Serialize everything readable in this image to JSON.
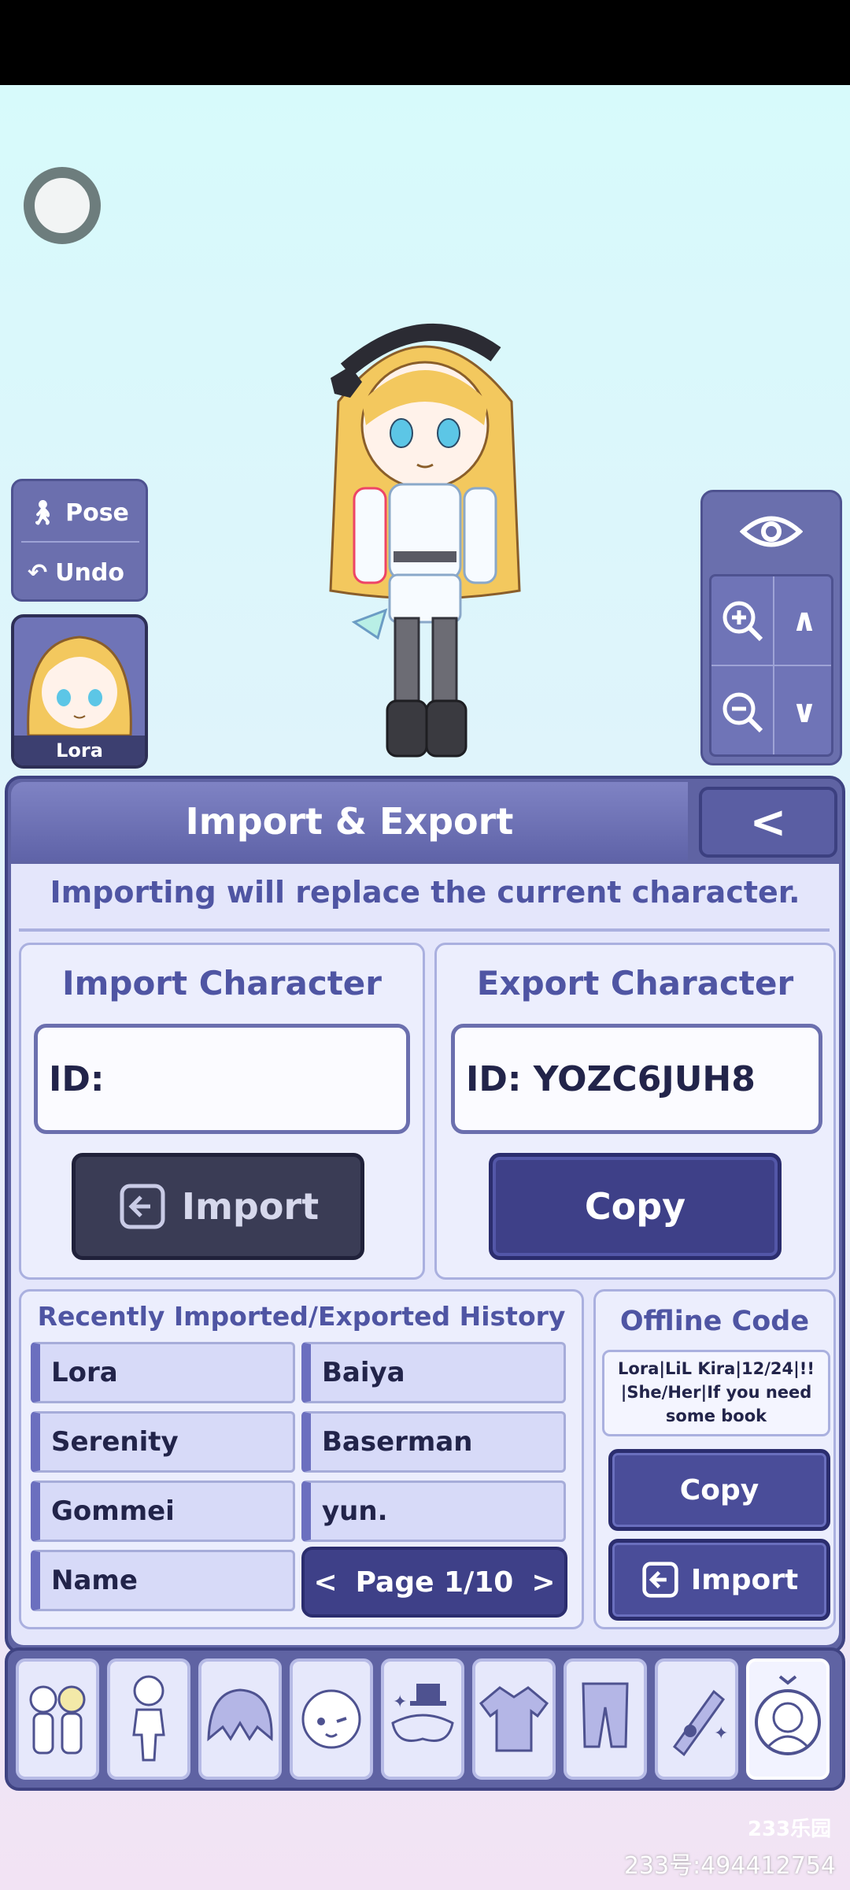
{
  "left_panel": {
    "pose_label": "Pose",
    "undo_label": "Undo",
    "character_name": "Lora"
  },
  "panel": {
    "title": "Import & Export",
    "back_label": "<",
    "warning": "Importing will replace the current character.",
    "import_box": {
      "title": "Import Character",
      "id_value": "ID:",
      "button_label": "Import"
    },
    "export_box": {
      "title": "Export Character",
      "id_value": "ID: YOZC6JUH8",
      "button_label": "Copy"
    },
    "history": {
      "title": "Recently Imported/Exported History",
      "items": [
        "Lora",
        "Baiya",
        "Serenity",
        "Baserman",
        "Gommei",
        "yun.",
        "Name"
      ],
      "page_label": "Page 1/10",
      "prev_label": "<",
      "next_label": ">"
    },
    "offline": {
      "title": "Offline Code",
      "code_text": "Lora|LiL Kira|12/24|!! |She/Her|If you need some book",
      "copy_label": "Copy",
      "import_label": "Import"
    }
  },
  "bottom_nav": {
    "icons": [
      "group-preset-icon",
      "body-icon",
      "hair-icon",
      "face-icon",
      "accessory-icon",
      "top-clothing-icon",
      "bottom-clothing-icon",
      "weapon-icon",
      "profile-icon"
    ],
    "active_index": 8
  },
  "watermark": {
    "logo": "233乐园",
    "text": "233号:494412754"
  },
  "colors": {
    "panel_bg": "#5f63a3",
    "content_bg": "#e4e6fb",
    "accent_text": "#4f55a3",
    "button_blue": "#3e4088",
    "button_dark": "#3a3c55"
  }
}
